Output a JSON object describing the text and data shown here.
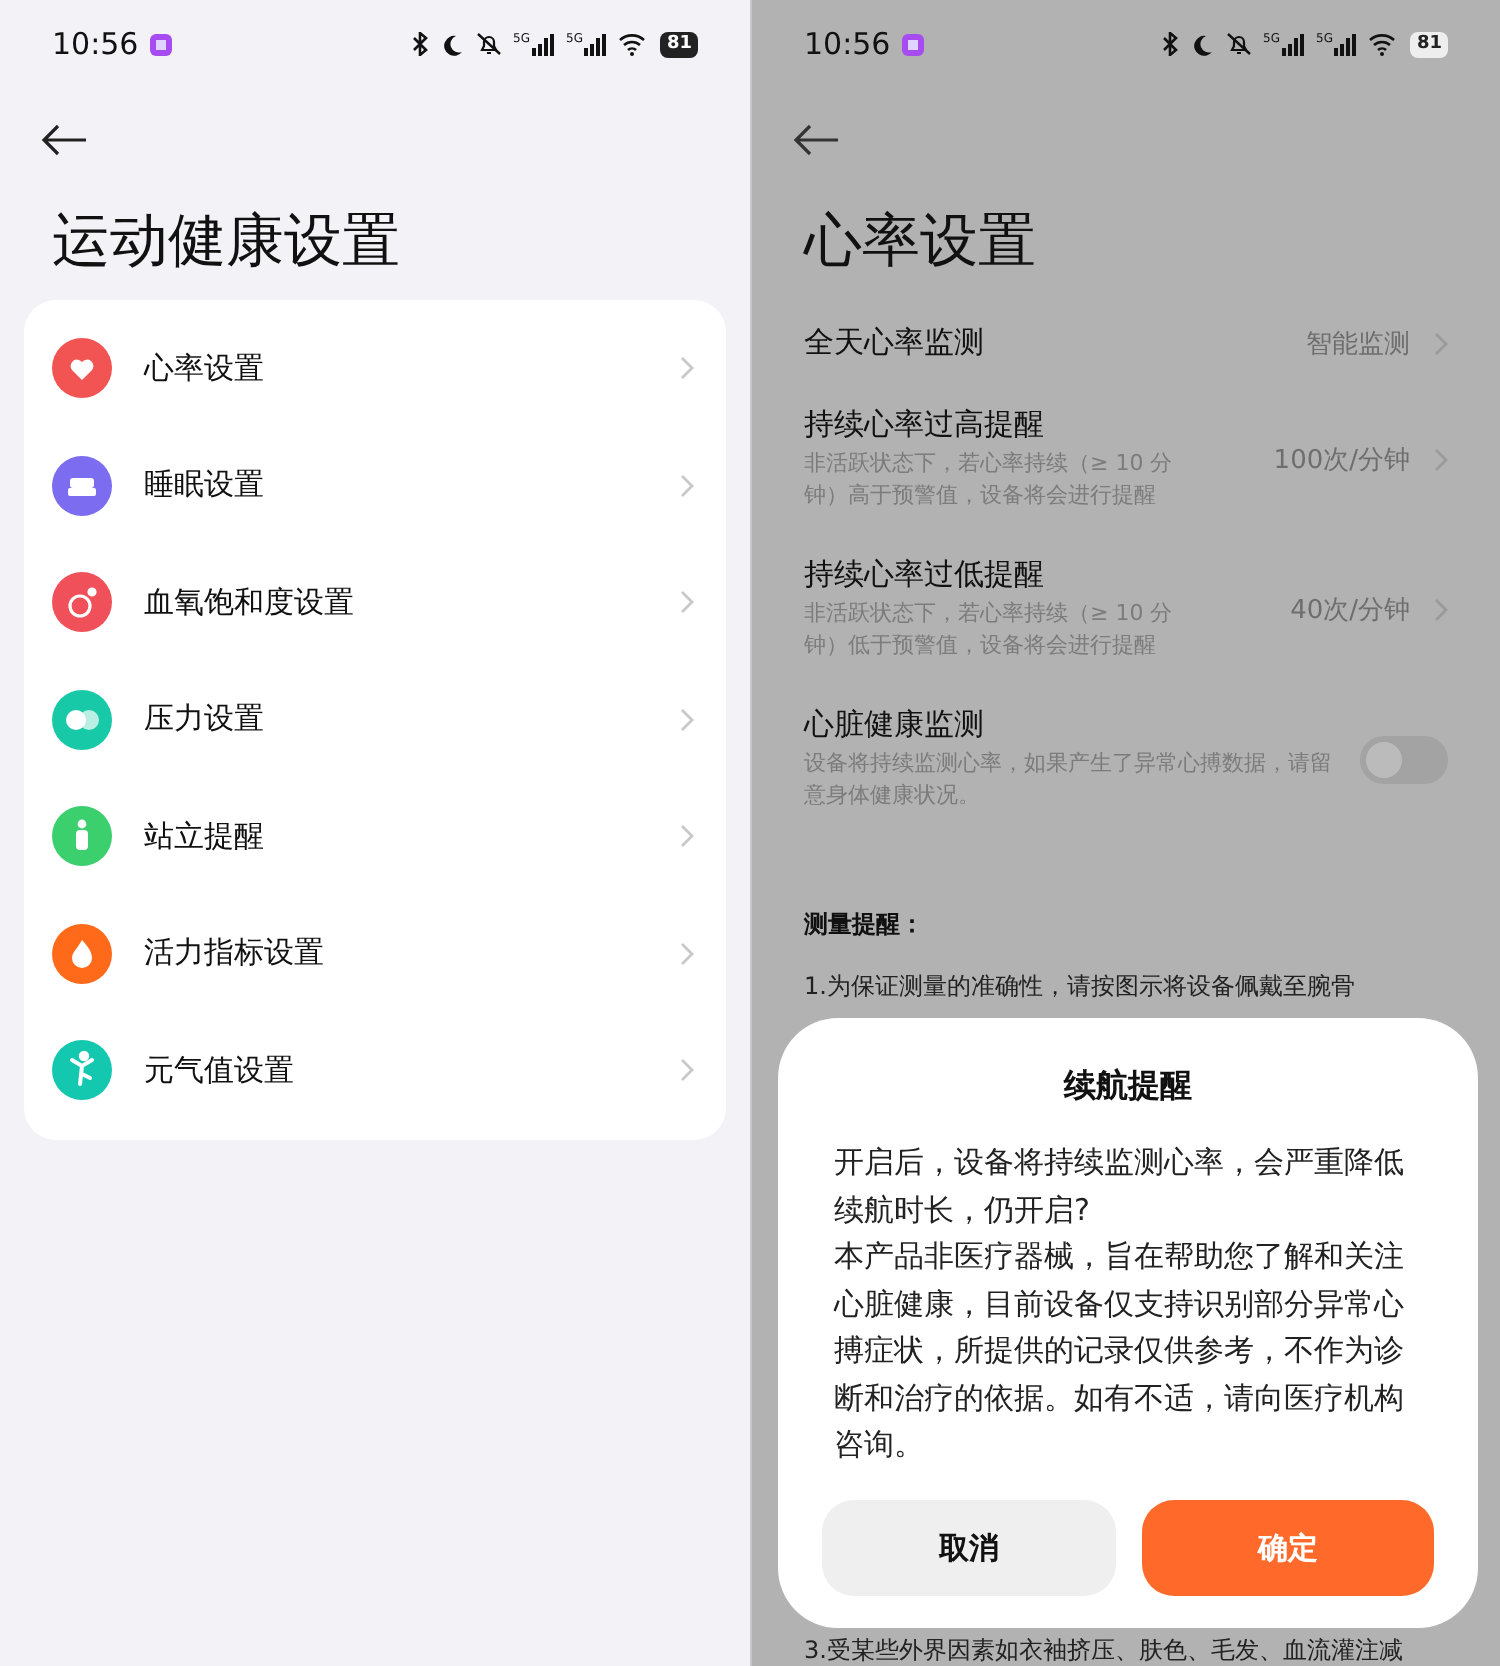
{
  "left_screen": {
    "status_bar": {
      "time": "10:56",
      "networks": [
        "5G",
        "5G"
      ],
      "battery": "81"
    },
    "title": "运动健康设置",
    "items": [
      {
        "label": "心率设置",
        "kind": "heart",
        "color": "#f25454"
      },
      {
        "label": "睡眠设置",
        "kind": "bed",
        "color": "#7b6cf0"
      },
      {
        "label": "血氧饱和度设置",
        "kind": "oxygen",
        "color": "#f0505a"
      },
      {
        "label": "压力设置",
        "kind": "faces",
        "color": "#18c9a8"
      },
      {
        "label": "站立提醒",
        "kind": "stand",
        "color": "#3ccf6e"
      },
      {
        "label": "活力指标设置",
        "kind": "flame",
        "color": "#ff6a1a"
      },
      {
        "label": "元气值设置",
        "kind": "dance",
        "color": "#14c8b0"
      }
    ]
  },
  "right_screen": {
    "status_bar": {
      "time": "10:56",
      "networks": [
        "5G",
        "5G"
      ],
      "battery": "81"
    },
    "title": "心率设置",
    "rows": [
      {
        "kind": "value",
        "title": "全天心率监测",
        "value": "智能监测"
      },
      {
        "kind": "value",
        "title": "持续心率过高提醒",
        "description": "非活跃状态下，若心率持续（≥ 10 分钟）高于预警值，设备将会进行提醒",
        "value": "100次/分钟"
      },
      {
        "kind": "value",
        "title": "持续心率过低提醒",
        "description": "非活跃状态下，若心率持续（≥ 10 分钟）低于预警值，设备将会进行提醒",
        "value": "40次/分钟"
      },
      {
        "kind": "toggle",
        "title": "心脏健康监测",
        "description": "设备将持续监测心率，如果产生了异常心搏数据，请留意身体健康状况。",
        "on": false
      }
    ],
    "notes_heading": "测量提醒：",
    "notes": [
      "1.为保证测量的准确性，请按图示将设备佩戴至腕骨",
      "3.受某些外界因素如衣袖挤压、肤色、毛发、血流灌注减"
    ],
    "dialog": {
      "title": "续航提醒",
      "paragraphs": [
        "开启后，设备将持续监测心率，会严重降低续航时长，仍开启?",
        "本产品非医疗器械，旨在帮助您了解和关注心脏健康，目前设备仅支持识别部分异常心搏症状，所提供的记录仅供参考，不作为诊断和治疗的依据。如有不适，请向医疗机构咨询。"
      ],
      "buttons": [
        {
          "label": "取消",
          "kind": "cancel"
        },
        {
          "label": "确定",
          "kind": "confirm"
        }
      ]
    }
  }
}
